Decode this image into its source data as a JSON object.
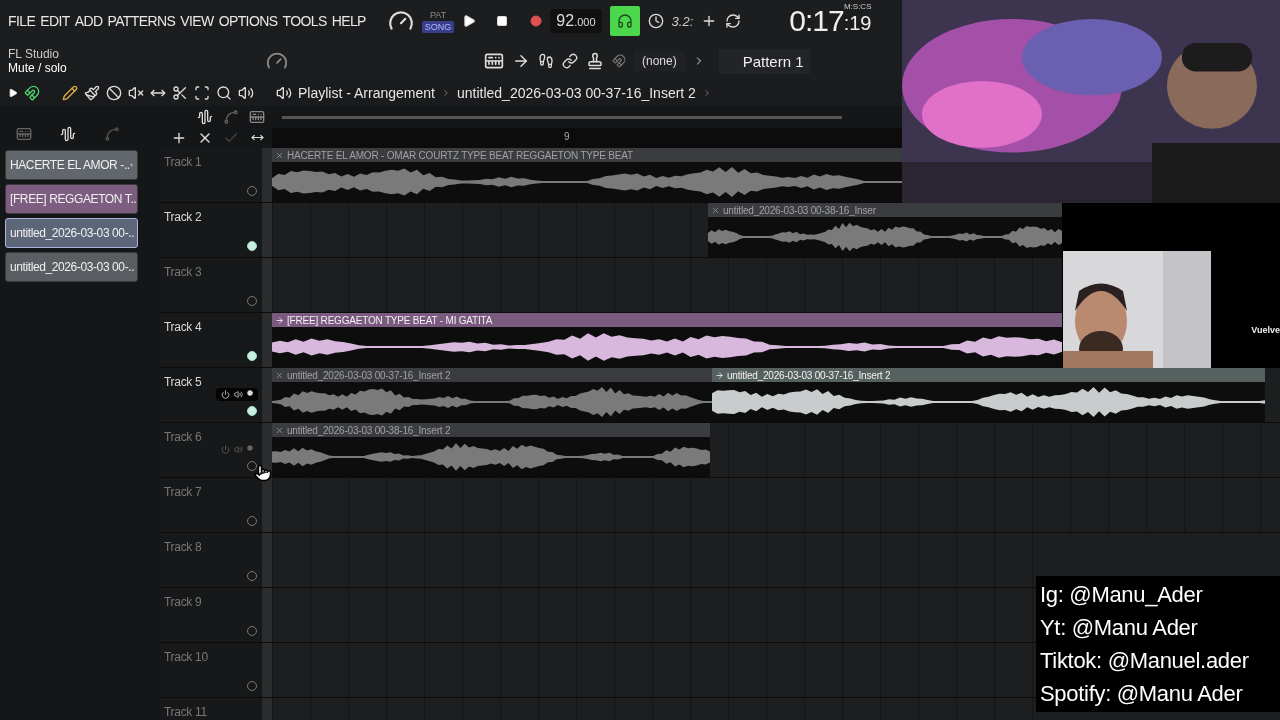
{
  "menu": [
    "FILE",
    "EDIT",
    "ADD",
    "PATTERNS",
    "VIEW",
    "OPTIONS",
    "TOOLS",
    "HELP"
  ],
  "transport": {
    "modes": [
      {
        "label": "PAT",
        "selected": false
      },
      {
        "label": "SONG",
        "selected": true
      }
    ],
    "tempo": {
      "whole": "92",
      "fraction": ".000"
    },
    "metronome_on": true,
    "countdown": "3.2:",
    "time": {
      "main": "0:17",
      "sub": ":19",
      "format": "M:S:CS"
    }
  },
  "hint": {
    "title": "FL Studio",
    "text": "Mute / solo"
  },
  "snap": "(none)",
  "pattern": "Pattern 1",
  "breadcrumb": {
    "title": "Playlist - Arrangement",
    "path": "untitled_2026-03-03 00-37-16_Insert 2"
  },
  "ruler": [
    "9"
  ],
  "picker": [
    {
      "label": "HACERTE EL AMOR -..",
      "kind": "sample",
      "color": "#62676e",
      "selected": false
    },
    {
      "label": "[FREE] REGGAETON T..",
      "kind": "sample",
      "color": "#7d5e80",
      "selected": false
    },
    {
      "label": "untitled_2026-03-03 00-..",
      "kind": "audio",
      "color": "#5d6678",
      "selected": true
    },
    {
      "label": "untitled_2026-03-03 00-..",
      "kind": "audio",
      "color": "#5a5e63",
      "selected": false
    }
  ],
  "tracks": [
    {
      "name": "Track 1",
      "active": false,
      "controls": false,
      "clips": [
        {
          "title": "HACERTE EL AMOR - OMAR COURTZ TYPE BEAT  REGGAETON TYPE BEAT",
          "color": "#3a3c3f",
          "selected": false
        }
      ]
    },
    {
      "name": "Track 2",
      "active": true,
      "controls": false,
      "clips": [
        {
          "title": "untitled_2026-03-03 00-38-16_Inser",
          "color": "#3a3c3f",
          "selected": false
        }
      ]
    },
    {
      "name": "Track 3",
      "active": false,
      "controls": false
    },
    {
      "name": "Track 4",
      "active": true,
      "controls": false,
      "clips": [
        {
          "title": "[FREE] REGGAETON TYPE BEAT - MI GATITA",
          "color": "#7a5a7e",
          "selected": true
        }
      ]
    },
    {
      "name": "Track 5",
      "active": true,
      "controls": true,
      "clips": [
        {
          "title": "untitled_2026-03-03 00-37-16_Insert 2",
          "color": "#3a3c3f",
          "selected": false
        },
        {
          "title": "untitled_2026-03-03 00-37-16_Insert 2",
          "color": "#55605f",
          "selected": true
        }
      ]
    },
    {
      "name": "Track 6",
      "active": false,
      "controls": true,
      "clips": [
        {
          "title": "untitled_2026-03-03 00-38-16_Insert 2",
          "color": "#3a3c3f",
          "selected": false
        }
      ]
    },
    {
      "name": "Track 7",
      "active": false,
      "controls": false
    },
    {
      "name": "Track 8",
      "active": false,
      "controls": false
    },
    {
      "name": "Track 9",
      "active": false,
      "controls": false
    },
    {
      "name": "Track 10",
      "active": false,
      "controls": false
    },
    {
      "name": "Track 11",
      "controls": false
    }
  ],
  "overlay": {
    "side_text": "Vuelve",
    "socials": [
      "Ig: @Manu_Ader",
      "Yt: @Manu Ader",
      "Tiktok: @Manuel.ader",
      "Spotify: @Manu Ader"
    ]
  }
}
